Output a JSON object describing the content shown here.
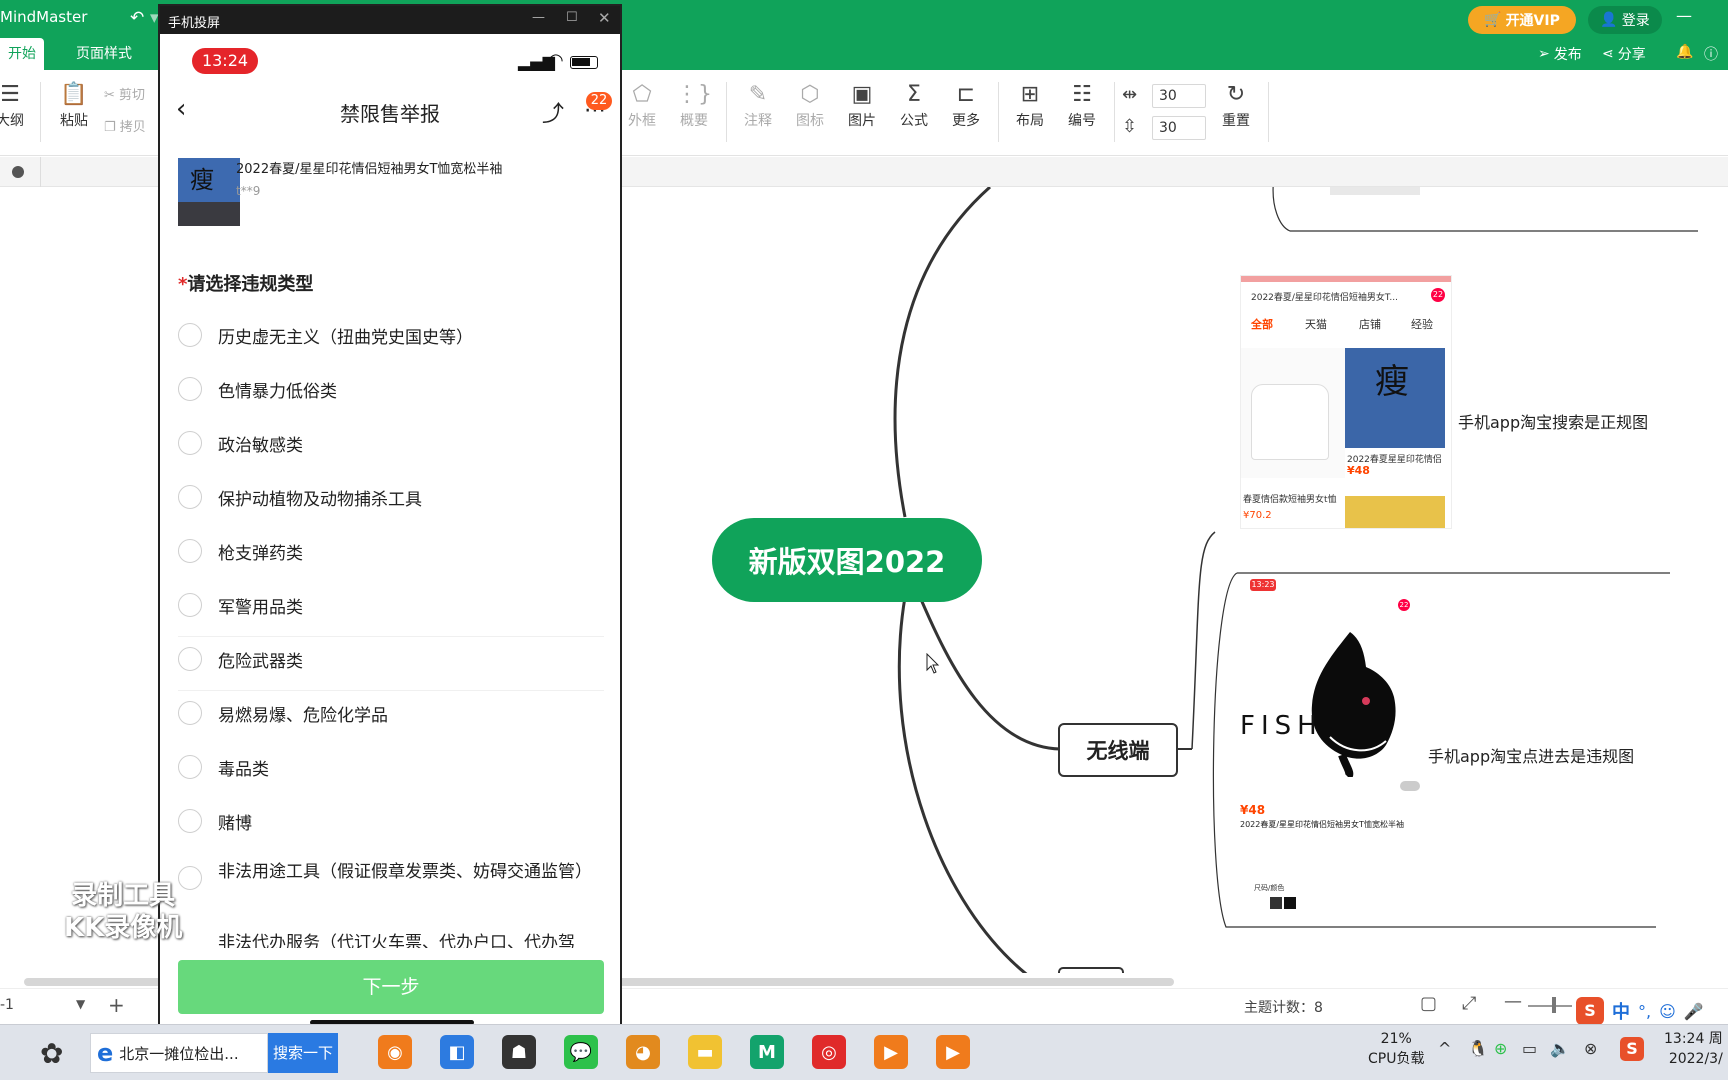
{
  "app": {
    "title": "MindMaster",
    "vip_label": "开通VIP",
    "login_label": "登录",
    "publish_label": "发布",
    "share_label": "分享"
  },
  "tabs": {
    "home": "开始",
    "page_style": "页面样式"
  },
  "toolbar": {
    "outline": "大纲",
    "paste": "粘贴",
    "cut": "剪切",
    "copy": "拷贝",
    "border": "外框",
    "summary": "概要",
    "note": "注释",
    "icon": "图标",
    "picture": "图片",
    "formula": "公式",
    "more": "更多",
    "layout": "布局",
    "numbering": "编号",
    "spacing_h": "30",
    "spacing_v": "30",
    "reset": "重置"
  },
  "phone_window": {
    "title": "手机投屏",
    "time": "13:24",
    "page_title": "禁限售举报",
    "badge_count": "22",
    "product_name": "2022春夏/星星印花情侣短袖男女T恤宽松半袖",
    "product_user": "t**9",
    "product_thumb_char": "瘦",
    "section_required_mark": "*",
    "section_title": "请选择违规类型",
    "options": [
      "历史虚无主义（扭曲党史国史等）",
      "色情暴力低俗类",
      "政治敏感类",
      "保护动植物及动物捕杀工具",
      "枪支弹药类",
      "军警用品类",
      "危险武器类",
      "易燃易爆、危险化学品",
      "毒品类",
      "赌博",
      "非法用途工具（假证假章发票类、妨碍交通监管）",
      "非法代办服务（代订火车票、代办户口、代办驾"
    ],
    "next_button": "下一步"
  },
  "mindmap": {
    "central": "新版双图2022",
    "branch_wireless": "无线端",
    "label_search": "手机app淘宝搜索是正规图",
    "label_click": "手机app淘宝点进去是违规图",
    "fish_text": "FISH",
    "mini_search_title": "2022春夏/星星印花情侣短袖男女T...",
    "mini_tabs": [
      "全部",
      "天猫",
      "店铺",
      "经验"
    ],
    "mini_price_1": "¥48",
    "mini_product_1": "2022春夏星星印花情侣",
    "mini_product_2": "春夏情侣款短袖男女t恤",
    "mini_price_2": "¥70.2",
    "mini_time": "13:23",
    "mini_badge": "22",
    "mini_detail_price": "¥48",
    "mini_detail_title": "2022春夏/星星印花情侣短袖男女T恤宽松半袖",
    "mini_spec": "尺码/颜色"
  },
  "status": {
    "page_sel": "-1",
    "topic_count_label": "主题计数：",
    "topic_count": "8"
  },
  "watermark": {
    "line1": "录制工具",
    "line2": "KK录像机"
  },
  "taskbar": {
    "browser_tab": "北京一摊位检出...",
    "search_btn": "搜索一下",
    "cpu_pct": "21%",
    "cpu_label": "CPU负载",
    "clock_time": "13:24 周",
    "clock_date": "2022/3/",
    "ime_lang": "中"
  }
}
